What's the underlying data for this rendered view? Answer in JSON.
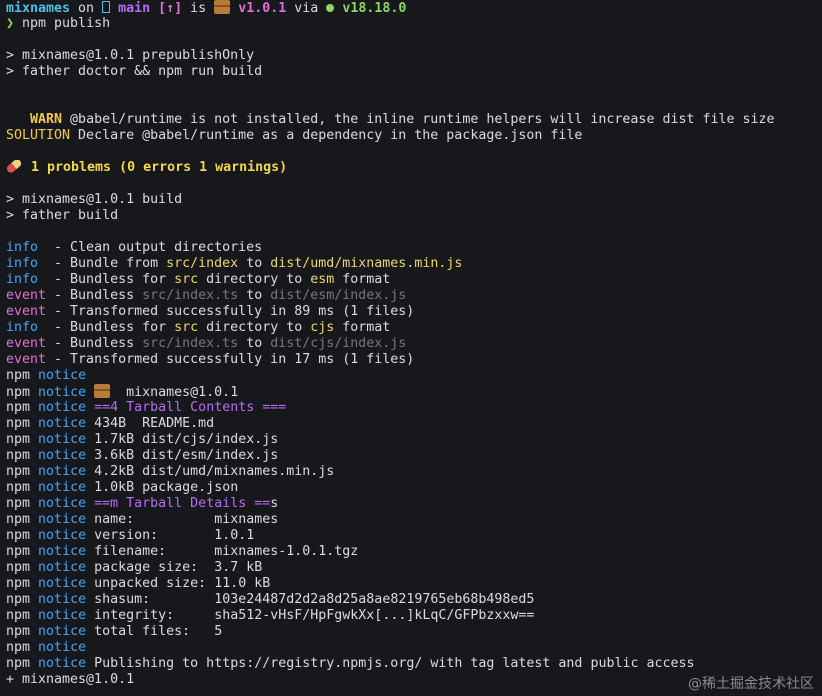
{
  "prompt": {
    "dir": "mixnames",
    "on": " on ",
    "branch": "main",
    "status": "[↑]",
    "is": " is ",
    "version": "v1.0.1",
    "via": " via ",
    "node": "v18.18.0",
    "symbol": "❯",
    "command": " npm publish"
  },
  "script1": [
    "> mixnames@1.0.1 prepublishOnly",
    "> father doctor && npm run build"
  ],
  "warn": {
    "tag": "   WARN",
    "text": " @babel/runtime is not installed, the inline runtime helpers will increase dist file size",
    "solution_tag": "SOLUTION",
    "solution_text": " Declare @babel/runtime as a dependency in the package.json file"
  },
  "problems": " 1 problems (0 errors 1 warnings)",
  "script2": [
    "> mixnames@1.0.1 build",
    "> father build"
  ],
  "build": [
    {
      "tag": "info ",
      "text": " - Clean output directories"
    },
    {
      "tag": "info ",
      "text": " - Bundle from ",
      "a": "src/index",
      "m": " to ",
      "b": "dist/umd/mixnames.min.js",
      "e": ""
    },
    {
      "tag": "info ",
      "text": " - Bundless for ",
      "a": "src",
      "m": " directory to ",
      "b": "esm",
      "e": " format"
    },
    {
      "tag": "event",
      "text": " - Bundless ",
      "g1": "src/index.ts",
      "m": " to ",
      "g2": "dist/esm/index.js"
    },
    {
      "tag": "event",
      "text": " - Transformed successfully in 89 ms (1 files)"
    },
    {
      "tag": "info ",
      "text": " - Bundless for ",
      "a": "src",
      "m": " directory to ",
      "b": "cjs",
      "e": " format"
    },
    {
      "tag": "event",
      "text": " - Bundless ",
      "g1": "src/index.ts",
      "m": " to ",
      "g2": "dist/cjs/index.js"
    },
    {
      "tag": "event",
      "text": " - Transformed successfully in 17 ms (1 files)"
    }
  ],
  "npm": "npm",
  "notice": "notice",
  "notices": {
    "pkg_line": "  mixnames@1.0.1",
    "contents_pre": "==",
    "contents_mid": "4 Tarball Contents ===",
    "files": [
      "434B  README.md",
      "1.7kB dist/cjs/index.js",
      "3.6kB dist/esm/index.js",
      "4.2kB dist/umd/mixnames.min.js",
      "1.0kB package.json"
    ],
    "details_pre": "==",
    "details_mid": "m Tarball Details ==",
    "details_end": "s",
    "details": [
      {
        "k": "name:          ",
        "v": "mixnames"
      },
      {
        "k": "version:       ",
        "v": "1.0.1"
      },
      {
        "k": "filename:      ",
        "v": "mixnames-1.0.1.tgz"
      },
      {
        "k": "package size:  ",
        "v": "3.7 kB"
      },
      {
        "k": "unpacked size: ",
        "v": "11.0 kB"
      },
      {
        "k": "shasum:        ",
        "v": "103e24487d2d2a8d25a8ae8219765eb68b498ed5"
      },
      {
        "k": "integrity:     ",
        "v": "sha512-vHsF/HpFgwkXx[...]kLqC/GFPbzxxw=="
      },
      {
        "k": "total files:   ",
        "v": "5"
      }
    ],
    "publishing": "Publishing to https://registry.npmjs.org/ with tag latest and public access"
  },
  "result": "+ mixnames@1.0.1",
  "watermark": "@稀土掘金技术社区"
}
